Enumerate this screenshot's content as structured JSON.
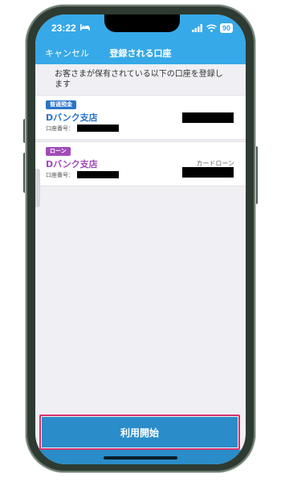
{
  "status_bar": {
    "time": "23:22",
    "battery": "90"
  },
  "nav": {
    "cancel_label": "キャンセル",
    "title": "登録される口座"
  },
  "description": "お客さまが保有されている以下の口座を登録します",
  "accounts": [
    {
      "badge": "普通預金",
      "branch": "Dバンク支店",
      "account_label": "口座番号：",
      "type_label": ""
    },
    {
      "badge": "ローン",
      "branch": "Dバンク支店",
      "account_label": "口座番号：",
      "type_label": "カードローン"
    }
  ],
  "cta": {
    "label": "利用開始"
  },
  "colors": {
    "header": "#36a9e8",
    "savings_accent": "#2a74c8",
    "loan_accent": "#a14bb9",
    "button": "#2a8cc8",
    "highlight": "#d6336c"
  },
  "icons": [
    "bed-icon",
    "signal-icon",
    "wifi-icon",
    "battery-icon"
  ]
}
